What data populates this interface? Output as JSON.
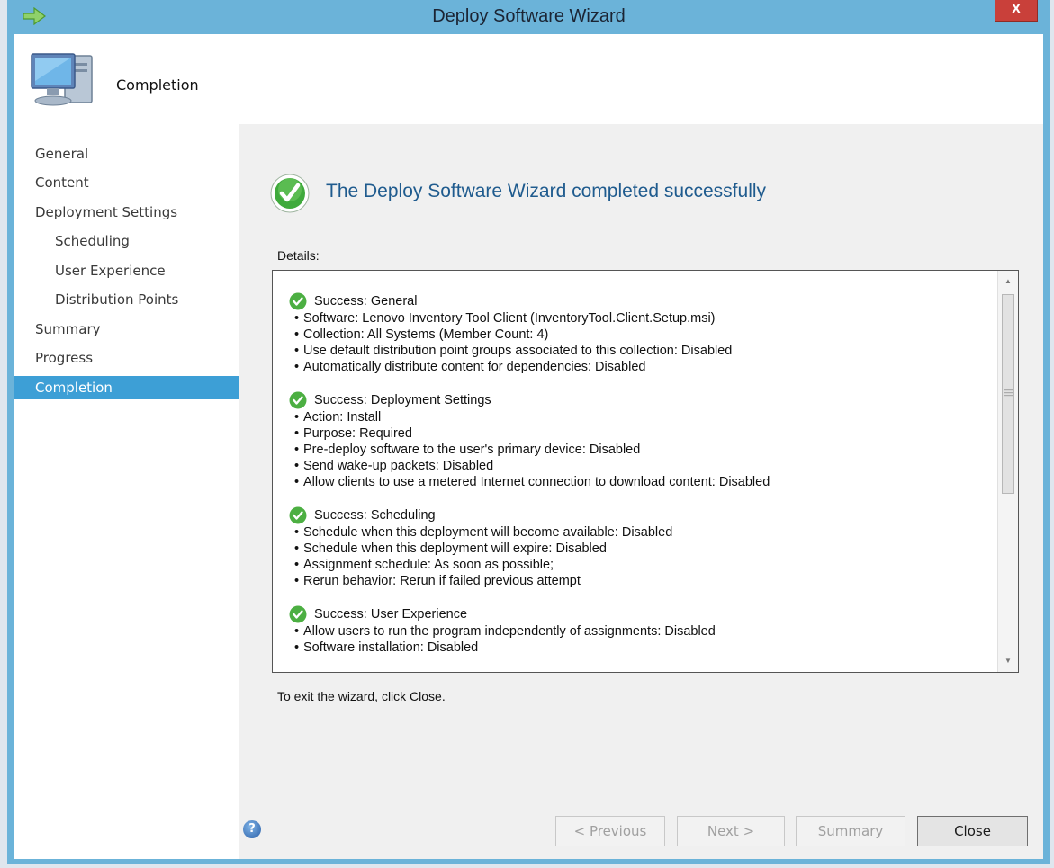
{
  "window": {
    "title": "Deploy Software Wizard",
    "close_label": "X"
  },
  "banner": {
    "page_title": "Completion"
  },
  "nav": {
    "items": [
      {
        "label": "General",
        "sub": false,
        "active": false
      },
      {
        "label": "Content",
        "sub": false,
        "active": false
      },
      {
        "label": "Deployment Settings",
        "sub": false,
        "active": false
      },
      {
        "label": "Scheduling",
        "sub": true,
        "active": false
      },
      {
        "label": "User Experience",
        "sub": true,
        "active": false
      },
      {
        "label": "Distribution Points",
        "sub": true,
        "active": false
      },
      {
        "label": "Summary",
        "sub": false,
        "active": false
      },
      {
        "label": "Progress",
        "sub": false,
        "active": false
      },
      {
        "label": "Completion",
        "sub": false,
        "active": true
      }
    ]
  },
  "main": {
    "headline": "The Deploy Software Wizard completed successfully",
    "details_label": "Details:",
    "exit_text": "To exit the wizard, click Close.",
    "sections": [
      {
        "heading": "Success: General",
        "bullets": [
          "Software: Lenovo Inventory Tool Client (InventoryTool.Client.Setup.msi)",
          "Collection: All Systems (Member Count: 4)",
          "Use default distribution point groups associated to this collection: Disabled",
          "Automatically distribute content for dependencies: Disabled"
        ]
      },
      {
        "heading": "Success: Deployment Settings",
        "bullets": [
          "Action: Install",
          "Purpose: Required",
          "Pre-deploy software to the user's primary device: Disabled",
          "Send wake-up packets: Disabled",
          "Allow clients to use a metered Internet connection to download content: Disabled"
        ]
      },
      {
        "heading": "Success: Scheduling",
        "bullets": [
          "Schedule when this deployment will become available: Disabled",
          "Schedule when this deployment will expire: Disabled",
          "Assignment schedule: As soon as possible;",
          "Rerun behavior: Rerun if failed previous attempt"
        ]
      },
      {
        "heading": "Success: User Experience",
        "bullets": [
          "Allow users to run the program independently of assignments: Disabled",
          "Software installation: Disabled"
        ]
      }
    ]
  },
  "footer": {
    "help_label": "?",
    "previous_label": "< Previous",
    "next_label": "Next >",
    "summary_label": "Summary",
    "close_label": "Close"
  },
  "colors": {
    "title_bar": "#6bb3d9",
    "nav_active": "#3d9fd6",
    "headline": "#1f5b8e",
    "close_button": "#c9403a"
  }
}
